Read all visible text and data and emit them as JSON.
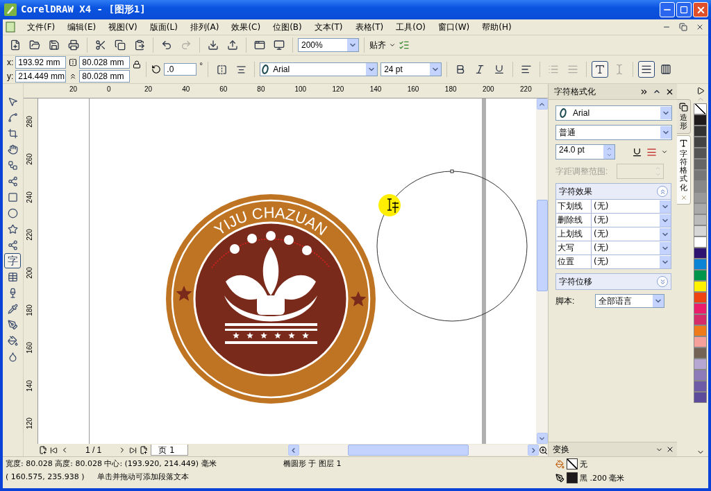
{
  "window": {
    "title": "CorelDRAW X4 - [图形1]"
  },
  "menu": [
    "文件(F)",
    "编辑(E)",
    "视图(V)",
    "版面(L)",
    "排列(A)",
    "效果(C)",
    "位图(B)",
    "文本(T)",
    "表格(T)",
    "工具(O)",
    "窗口(W)",
    "帮助(H)"
  ],
  "toolbar": {
    "buttons": [
      {
        "kind": "new",
        "disabled": false
      },
      {
        "kind": "open",
        "disabled": false
      },
      {
        "kind": "save",
        "disabled": false
      },
      {
        "kind": "print",
        "disabled": false
      },
      {
        "kind": "cut",
        "disabled": false
      },
      {
        "kind": "copy",
        "disabled": false
      },
      {
        "kind": "paste",
        "disabled": false
      },
      {
        "kind": "undo",
        "disabled": false
      },
      {
        "kind": "redo",
        "disabled": true
      },
      {
        "kind": "import",
        "disabled": false
      },
      {
        "kind": "export",
        "disabled": false
      },
      {
        "kind": "launcher",
        "disabled": false
      },
      {
        "kind": "welcome",
        "disabled": false
      }
    ],
    "zoom": "200%",
    "snap": "贴齐"
  },
  "properties": {
    "x_label": "x:",
    "x": "193.92 mm",
    "y_label": "y:",
    "y": "214.449 mm",
    "width": "80.028 mm",
    "height": "80.028 mm",
    "rotation": ".0",
    "degree": "°",
    "font": "Arial",
    "size": "24 pt",
    "buttons": [
      {
        "kind": "bold",
        "selected": false,
        "disabled": false
      },
      {
        "kind": "italic",
        "selected": false,
        "disabled": false
      },
      {
        "kind": "underline",
        "selected": false,
        "disabled": false
      },
      {
        "kind": "format",
        "selected": false,
        "disabled": false
      },
      {
        "kind": "bullets",
        "selected": false,
        "disabled": true
      },
      {
        "kind": "dropcap",
        "selected": false,
        "disabled": true
      },
      {
        "kind": "fit-path",
        "selected": true,
        "disabled": false
      },
      {
        "kind": "edit-text",
        "selected": false,
        "disabled": true
      },
      {
        "kind": "horizontal",
        "selected": true,
        "disabled": false
      },
      {
        "kind": "vertical",
        "selected": false,
        "disabled": false
      }
    ]
  },
  "tools": [
    {
      "kind": "pointer",
      "selected": false
    },
    {
      "kind": "shape",
      "selected": false
    },
    {
      "kind": "crop",
      "selected": false
    },
    {
      "kind": "hand",
      "selected": false
    },
    {
      "kind": "curve",
      "selected": false
    },
    {
      "kind": "smart",
      "selected": false
    },
    {
      "kind": "rectangle",
      "selected": false
    },
    {
      "kind": "ellipse",
      "selected": false
    },
    {
      "kind": "star",
      "selected": false
    },
    {
      "kind": "connector",
      "selected": false
    },
    {
      "kind": "text",
      "label": "字",
      "selected": true
    },
    {
      "kind": "table",
      "selected": false
    },
    {
      "kind": "glass",
      "selected": false
    },
    {
      "kind": "eyedropper",
      "selected": false
    },
    {
      "kind": "outline",
      "selected": false
    },
    {
      "kind": "fill",
      "selected": false
    },
    {
      "kind": "interactive-fill",
      "selected": false
    }
  ],
  "rulers": {
    "horizontal": [
      "20",
      "0",
      "20",
      "40",
      "60",
      "80",
      "100",
      "120",
      "140",
      "160",
      "180",
      "200",
      "220"
    ],
    "vertical": [
      "280",
      "260",
      "240",
      "220",
      "200",
      "180",
      "160",
      "140",
      "120"
    ]
  },
  "canvas": {
    "logo_text": "YIJU CHAZUAN"
  },
  "page_nav": {
    "counter": "1 / 1",
    "page_tab": "页 1"
  },
  "docker": {
    "title": "字符格式化",
    "font": "Arial",
    "style": "普通",
    "size": "24.0 pt",
    "kerning_label": "字距调整范围:",
    "kerning_disabled": true,
    "effects": {
      "title": "字符效果",
      "expanded": true,
      "rows": [
        {
          "label": "下划线",
          "value": "(无)"
        },
        {
          "label": "删除线",
          "value": "(无)"
        },
        {
          "label": "上划线",
          "value": "(无)"
        },
        {
          "label": "大写",
          "value": "(无)"
        },
        {
          "label": "位置",
          "value": "(无)"
        }
      ]
    },
    "shift": {
      "title": "字符位移",
      "expanded": false
    },
    "script_label": "脚本:",
    "script": "全部语言"
  },
  "docker_tabs": [
    {
      "label": "造形",
      "selected": false
    },
    {
      "label": "字符格式化",
      "selected": true
    }
  ],
  "transform_docker": {
    "title": "变换"
  },
  "palette": [
    {
      "color": "#1f1b1c"
    },
    {
      "color": "#333333"
    },
    {
      "color": "#444444"
    },
    {
      "color": "#555555"
    },
    {
      "color": "#666666"
    },
    {
      "color": "#777777"
    },
    {
      "color": "#888888"
    },
    {
      "color": "#999999"
    },
    {
      "color": "#aaaaaa"
    },
    {
      "color": "#bbbbbb"
    },
    {
      "color": "#d6d6d6"
    },
    {
      "color": "#ffffff"
    },
    {
      "color": "#2e1470"
    },
    {
      "color": "#0b84d6"
    },
    {
      "color": "#00954a"
    },
    {
      "color": "#fff200"
    },
    {
      "color": "#ef4411"
    },
    {
      "color": "#ec1c6c"
    },
    {
      "color": "#d42b6a"
    },
    {
      "color": "#ef7a1a"
    },
    {
      "color": "#f5a09a"
    },
    {
      "color": "#736357"
    },
    {
      "color": "#b6a6d2"
    },
    {
      "color": "#8c7bb8"
    },
    {
      "color": "#6d5ba8"
    },
    {
      "color": "#5c4a9a"
    }
  ],
  "status": {
    "line1": "宽度: 80.028 高度: 80.028 中心: (193.920, 214.449) 毫米",
    "object": "椭圆形 于 图层 1",
    "coords": "( 160.575, 235.938 )",
    "hint": "单击并拖动可添加段落文本",
    "fill": {
      "kind": "none",
      "label": "无"
    },
    "outline": {
      "color": "#1f1b1c",
      "label": "黑 .200 毫米"
    }
  }
}
